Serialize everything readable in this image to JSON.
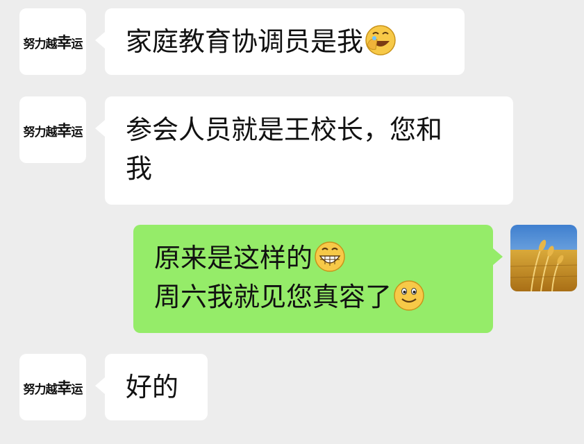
{
  "chat": {
    "messages": [
      {
        "side": "left",
        "avatar": "logo-avatar",
        "lines": [
          "家庭教育协调员是我"
        ],
        "emoji": "face-palm-laugh-emoji"
      },
      {
        "side": "left",
        "avatar": "logo-avatar",
        "lines": [
          "参会人员就是王校长，您和",
          "我"
        ]
      },
      {
        "side": "right",
        "avatar": "wheat-field-avatar",
        "lines": [
          "原来是这样的",
          "周六我就见您真容了"
        ],
        "emojis": [
          "grin-emoji",
          "smile-emoji"
        ]
      },
      {
        "side": "left",
        "avatar": "logo-avatar",
        "lines": [
          "好的"
        ]
      }
    ]
  },
  "logo": {
    "top": "越",
    "left": "努力",
    "middle": "越",
    "right": "幸运",
    "big": "幸"
  }
}
